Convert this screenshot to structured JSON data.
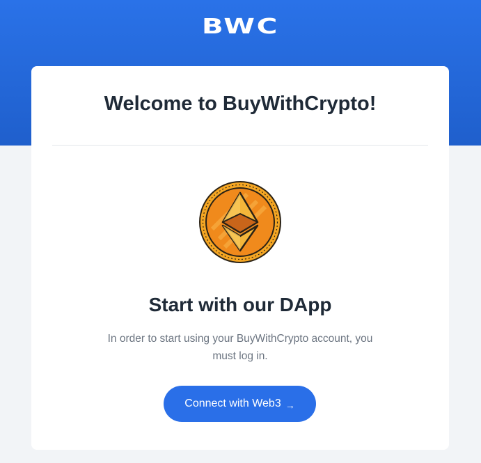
{
  "header": {
    "logo_text": "BWC",
    "background_color": "#2a72e8"
  },
  "card": {
    "title": "Welcome to BuyWithCrypto!",
    "coin_icon": "ethereum-coin-icon",
    "subtitle": "Start with our DApp",
    "description": "In order to start using your BuyWithCrypto account, you must log in.",
    "button": {
      "label": "Connect with Web3",
      "arrow": "→",
      "color": "#2a6fe8"
    }
  }
}
